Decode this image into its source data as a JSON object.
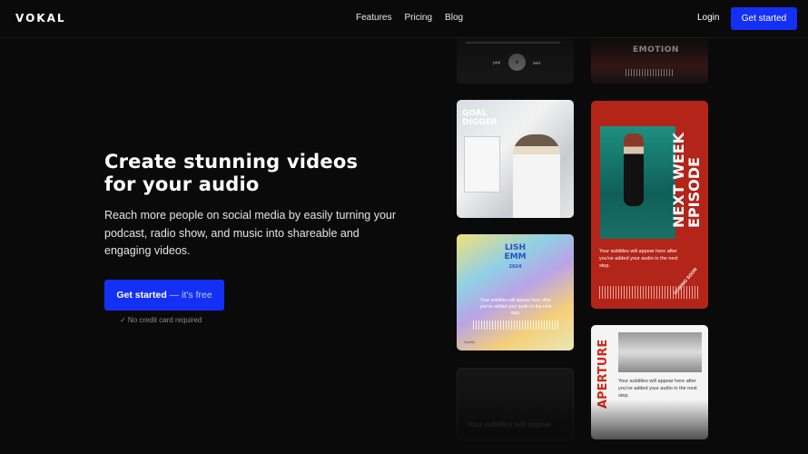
{
  "nav": {
    "logo": "VOKAL",
    "links": [
      "Features",
      "Pricing",
      "Blog"
    ],
    "login": "Login",
    "cta": "Get started"
  },
  "hero": {
    "title_line1": "Create stunning videos",
    "title_line2": "for your audio",
    "description": "Reach more people on social media by easily turning your podcast, radio show, and music into shareable and engaging videos.",
    "cta_bold": "Get started",
    "cta_light": "— it's free",
    "note": "✓ No credit card required"
  },
  "cards": {
    "player": {
      "controls": [
        "⏮",
        "⏸",
        "⏭"
      ]
    },
    "emotion": {
      "title": "EMOTION"
    },
    "goal": {
      "title_line1": "GOAL",
      "title_line2": "DIGGER"
    },
    "lish": {
      "title_line1": "LISH",
      "title_line2": "EMM",
      "year": "2024",
      "subtitle": "Your subtitles will appear here after you've added your audio in the next step.",
      "footer": "Spotify"
    },
    "next": {
      "title_line1": "NEXT WEEK",
      "title_line2": "EPISODE",
      "subtitle": "Your subtitles will appear here after you've added your audio in the next step.",
      "badge": "COMING SOON"
    },
    "aperture": {
      "title": "APERTURE",
      "subtitle": "Your subtitles will appear here after you've added your audio in the next step."
    },
    "dark": {
      "subtitle": "Your subtitles will appear"
    }
  },
  "colors": {
    "accent": "#1530f5",
    "background": "#0a0a0a",
    "card_red": "#b32419"
  }
}
